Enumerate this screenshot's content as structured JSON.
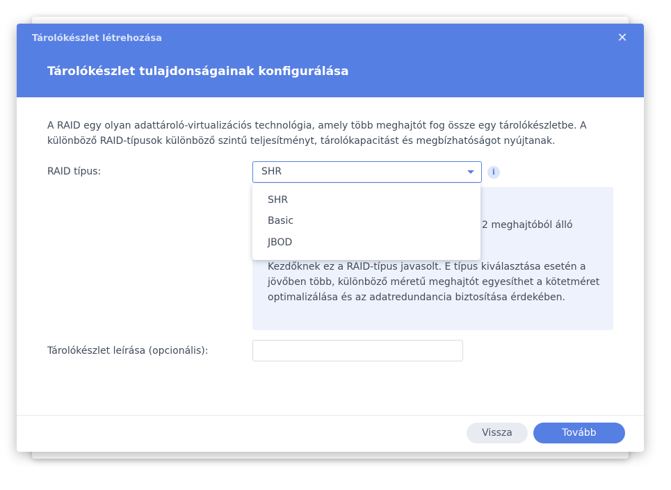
{
  "dialog": {
    "window_title": "Tárolókészlet létrehozása",
    "close_symbol": "✕",
    "subtitle": "Tárolókészlet tulajdonságainak konfigurálása",
    "description": "A RAID egy olyan adattároló-virtualizációs technológia, amely több meghajtót fog össze egy tárolókészletbe. A különböző RAID-típusok különböző szintű teljesítményt, tárolókapacitást és megbízhatóságot nyújtanak."
  },
  "raid": {
    "label": "RAID típus:",
    "selected": "SHR",
    "options": [
      "SHR",
      "Basic",
      "JBOD"
    ],
    "info_symbol": "i",
    "info_partial": "2 meghajtóból álló",
    "info_text": "Kezdőknek ez a RAID-típus javasolt. E típus kiválasztása esetén a jövőben több, különböző méretű meghajtót egyesíthet a kötetméret optimalizálása és az adatredundancia biztosítása érdekében."
  },
  "description_field": {
    "label": "Tárolókészlet leírása (opcionális):",
    "value": ""
  },
  "footer": {
    "back_label": "Vissza",
    "next_label": "Tovább"
  },
  "colors": {
    "accent": "#567fe3",
    "info_bg": "#eef2fc"
  },
  "icons": {
    "close": "close-icon",
    "info": "info-icon",
    "dropdown": "chevron-down-icon"
  }
}
